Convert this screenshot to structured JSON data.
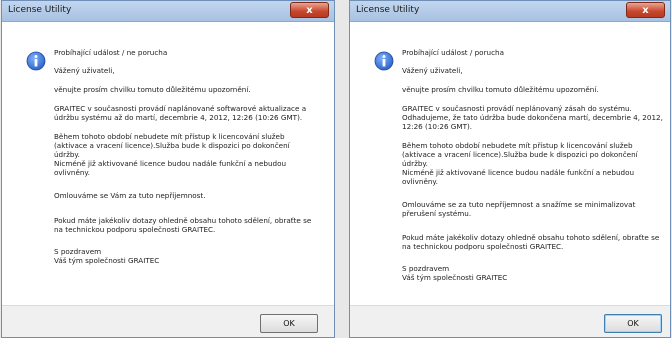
{
  "left_window": {
    "title": "License Utility",
    "close_glyph": "x",
    "icon": "info-icon",
    "lines": [
      "Probíhající událost / ne porucha",
      "Vážený uživateli,",
      "věnujte prosím chvilku tomuto důležitému upozornění.",
      "GRAITEC v současnosti provádí naplánované softwarové aktualizace a",
      "údržbu systému až do martí, decembrie 4, 2012, 12:26 (10:26 GMT).",
      "Během tohoto období nebudete mít přístup k licencování služeb",
      "(aktivace a vracení licence).Služba bude k dispozici po dokončení",
      "údržby.",
      "Nicméně již aktivované licence budou nadále funkční a nebudou",
      "ovlivněny.",
      "Omlouváme se Vám za tuto nepříjemnost.",
      "Pokud máte jakékoliv dotazy ohledně obsahu tohoto sdělení, obraťte se",
      "na  technickou podporu společnosti GRAITEC.",
      "S pozdravem",
      "Váš tým společnosti GRAITEC"
    ],
    "ok_label": "OK"
  },
  "right_window": {
    "title": "License Utility",
    "close_glyph": "x",
    "icon": "info-icon",
    "lines": [
      "Probíhající událost / porucha",
      "Vážený uživateli,",
      "věnujte prosím chvilku tomuto důležitému upozornění.",
      "GRAITEC v současnosti provádí neplánovaný zásah do systému.",
      "Odhadujeme, že tato údržba bude dokončena martí, decembrie 4, 2012,",
      "12:26 (10:26 GMT).",
      "Během tohoto období nebudete mít přístup k licencování služeb",
      "(aktivace a vracení licence).Služba bude k dispozici po dokončení",
      "údržby.",
      "Nicméně již aktivované licence budou nadále funkční a nebudou",
      "ovlivněny.",
      "Omlouváme se za tuto nepříjemnost a  snažíme se minimalizovat",
      "přerušení systému.",
      "Pokud máte jakékoliv dotazy ohledně obsahu tohoto sdělení, obraťte se",
      "na  technickou podporu společnosti GRAITEC.",
      "S pozdravem",
      "Váš tým společnosti GRAITEC"
    ],
    "ok_label": "OK"
  },
  "colors": {
    "info_icon_fill": "#2f66c9",
    "close_button": "#c7462c"
  }
}
